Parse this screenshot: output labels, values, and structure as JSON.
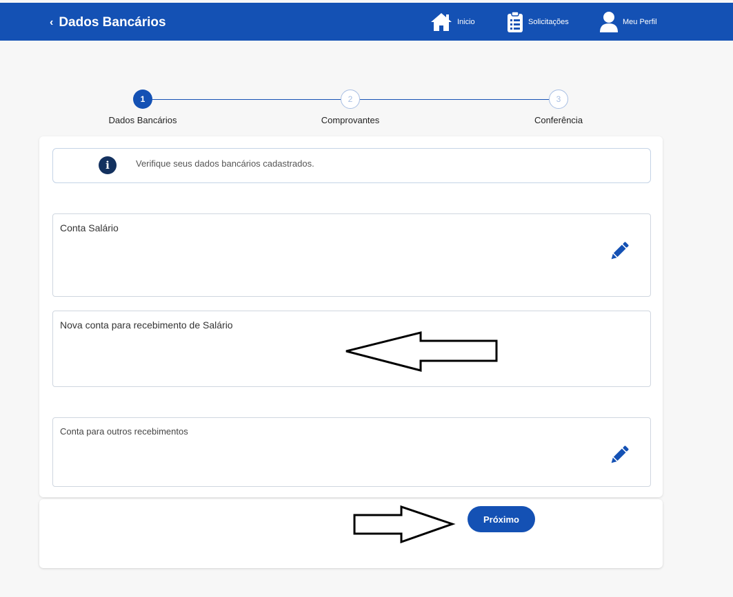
{
  "header": {
    "back_label": "Dados Bancários",
    "nav": [
      {
        "label": "Inicio",
        "icon": "home-icon"
      },
      {
        "label": "Solicitações",
        "icon": "clipboard-list-icon"
      },
      {
        "label": "Meu Perfil",
        "icon": "user-icon"
      }
    ]
  },
  "stepper": {
    "current_step": 1,
    "steps": [
      {
        "number": "1",
        "label": "Dados Bancários",
        "state": "active"
      },
      {
        "number": "2",
        "label": "Comprovantes",
        "state": "inactive"
      },
      {
        "number": "3",
        "label": "Conferência",
        "state": "inactive"
      }
    ]
  },
  "info": {
    "icon": "info-icon",
    "text": "Verifique seus dados bancários cadastrados."
  },
  "accounts": [
    {
      "title": "Conta Salário",
      "editable": true,
      "edit_icon": "pencil-icon"
    },
    {
      "title": "Nova conta para recebimento de Salário",
      "editable": false
    },
    {
      "title": "Conta para outros recebimentos",
      "editable": true,
      "edit_icon": "pencil-icon"
    }
  ],
  "actions": {
    "next_label": "Próximo"
  },
  "colors": {
    "primary": "#1451b4",
    "info_icon_bg": "#13315f",
    "page_bg": "#f7f7f7",
    "border": "#cfd6df"
  }
}
